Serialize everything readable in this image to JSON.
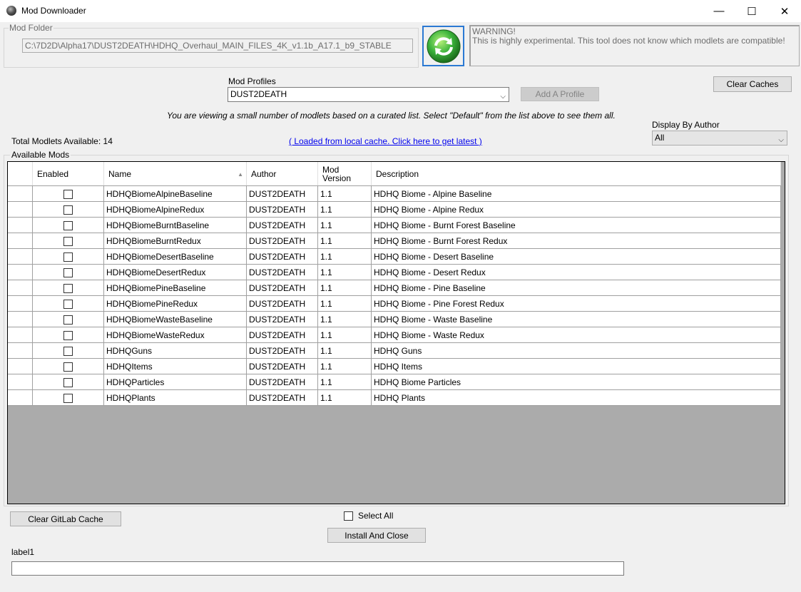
{
  "window": {
    "title": "Mod Downloader",
    "minimize_glyph": "—",
    "maximize_glyph": "☐",
    "close_glyph": "✕"
  },
  "mod_folder": {
    "label": "Mod Folder",
    "path": "C:\\7D2D\\Alpha17\\DUST2DEATH\\HDHQ_Overhaul_MAIN_FILES_4K_v1.1b_A17.1_b9_STABLE"
  },
  "warning": {
    "line1": "WARNING!",
    "line2": "This is highly experimental. This tool does not know which modlets are compatible!"
  },
  "profiles": {
    "label": "Mod Profiles",
    "selected": "DUST2DEATH",
    "add_button": "Add A Profile"
  },
  "clear_caches_button": "Clear Caches",
  "info_text": "You are viewing a small number of modlets based on a curated list.  Select \"Default\" from the list above to see them all.",
  "author_filter": {
    "label": "Display By Author",
    "selected": "All"
  },
  "total_label": "Total Modlets Available: 14",
  "cache_link": "( Loaded from local cache. Click here to get latest )",
  "available_mods_label": "Available Mods",
  "table": {
    "columns": {
      "enabled": "Enabled",
      "name": "Name",
      "author": "Author",
      "version_line1": "Mod",
      "version_line2": "Version",
      "description": "Description"
    },
    "rows": [
      {
        "name": "HDHQBiomeAlpineBaseline",
        "author": "DUST2DEATH",
        "version": "1.1",
        "description": "HDHQ Biome - Alpine Baseline"
      },
      {
        "name": "HDHQBiomeAlpineRedux",
        "author": "DUST2DEATH",
        "version": "1.1",
        "description": "HDHQ Biome - Alpine Redux"
      },
      {
        "name": "HDHQBiomeBurntBaseline",
        "author": "DUST2DEATH",
        "version": "1.1",
        "description": "HDHQ Biome - Burnt Forest Baseline"
      },
      {
        "name": "HDHQBiomeBurntRedux",
        "author": "DUST2DEATH",
        "version": "1.1",
        "description": "HDHQ Biome - Burnt Forest Redux"
      },
      {
        "name": "HDHQBiomeDesertBaseline",
        "author": "DUST2DEATH",
        "version": "1.1",
        "description": "HDHQ Biome - Desert Baseline"
      },
      {
        "name": "HDHQBiomeDesertRedux",
        "author": "DUST2DEATH",
        "version": "1.1",
        "description": "HDHQ Biome - Desert Redux"
      },
      {
        "name": "HDHQBiomePineBaseline",
        "author": "DUST2DEATH",
        "version": "1.1",
        "description": "HDHQ Biome - Pine Baseline"
      },
      {
        "name": "HDHQBiomePineRedux",
        "author": "DUST2DEATH",
        "version": "1.1",
        "description": "HDHQ Biome - Pine Forest Redux"
      },
      {
        "name": "HDHQBiomeWasteBaseline",
        "author": "DUST2DEATH",
        "version": "1.1",
        "description": "HDHQ Biome - Waste Baseline"
      },
      {
        "name": "HDHQBiomeWasteRedux",
        "author": "DUST2DEATH",
        "version": "1.1",
        "description": "HDHQ Biome - Waste Redux"
      },
      {
        "name": "HDHQGuns",
        "author": "DUST2DEATH",
        "version": "1.1",
        "description": "HDHQ Guns"
      },
      {
        "name": "HDHQItems",
        "author": "DUST2DEATH",
        "version": "1.1",
        "description": "HDHQ Items"
      },
      {
        "name": "HDHQParticles",
        "author": "DUST2DEATH",
        "version": "1.1",
        "description": "HDHQ Biome Particles"
      },
      {
        "name": "HDHQPlants",
        "author": "DUST2DEATH",
        "version": "1.1",
        "description": "HDHQ Plants"
      }
    ]
  },
  "clear_gitlab_button": "Clear GitLab Cache",
  "select_all_label": "Select All",
  "install_button": "Install And Close",
  "status_label": "label1",
  "status_value": "",
  "colors": {
    "accent_blue": "#2b79d3",
    "grid_background": "#ababab",
    "refresh_green": "#3cb43c"
  },
  "icons": {
    "app": "app-icon",
    "refresh": "refresh-icon",
    "dropdown": "chevron-down-icon"
  }
}
